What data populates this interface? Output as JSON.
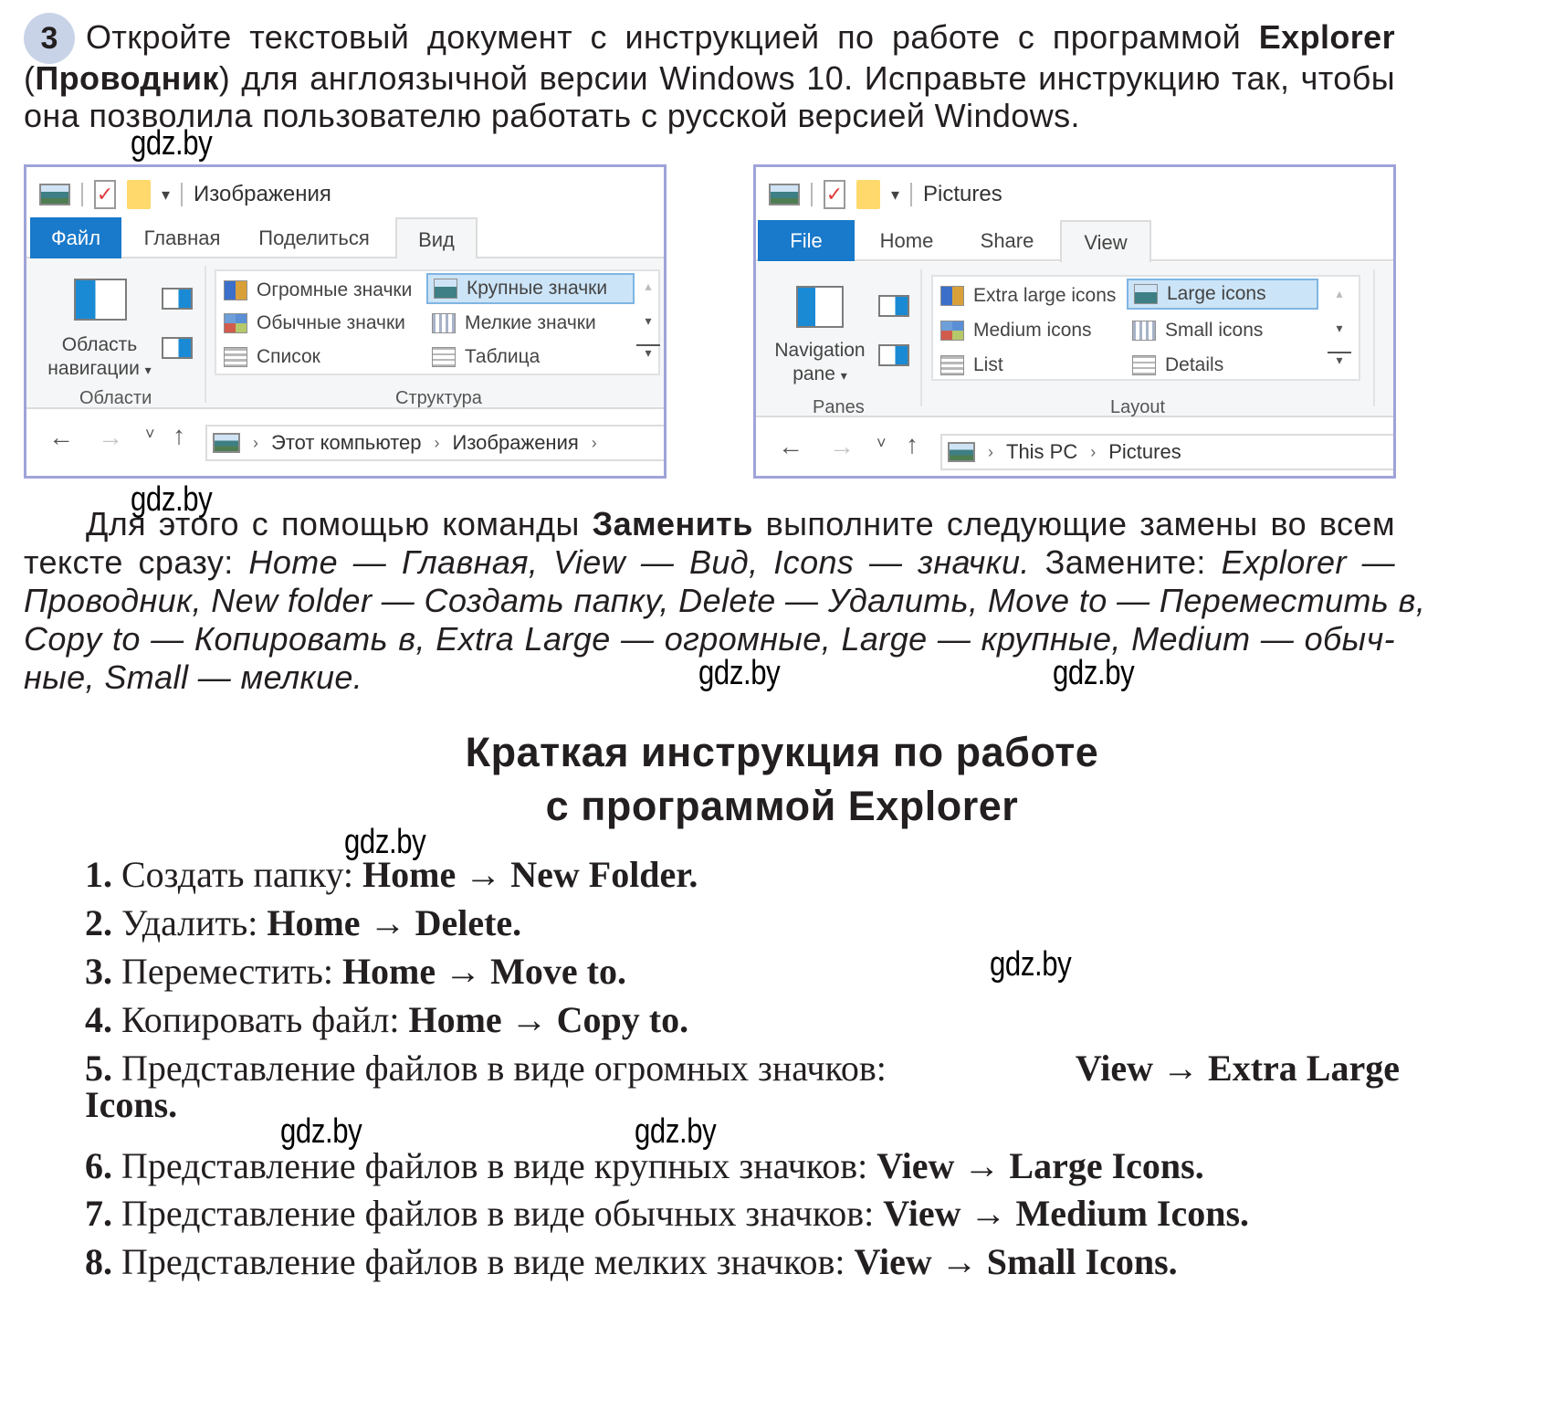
{
  "task": {
    "number": "3",
    "lines": [
      {
        "pre": "Откройте текстовый документ с инструкцией по работе с программой ",
        "bold": "Explorer",
        "post": ""
      },
      {
        "pre": "(",
        "bold": "Проводник",
        "post": ") для англоязычной версии Windows 10. Исправьте инструкцию так, чтобы"
      },
      {
        "pre": "она позволила пользователю работать с русской версией Windows.",
        "bold": "",
        "post": ""
      }
    ]
  },
  "watermarks": [
    "gdz.by",
    "gdz.by",
    "gdz.by",
    "gdz.by",
    "gdz.by",
    "gdz.by",
    "gdz.by",
    "gdz.by",
    "gdz.by",
    "gdz.by"
  ],
  "window_ru": {
    "title": "Изображения",
    "tabs": [
      "Файл",
      "Главная",
      "Поделиться",
      "Вид"
    ],
    "active_tab": "Вид",
    "panes_group": {
      "button": "Область навигации",
      "dropdown": "▾",
      "label": "Области"
    },
    "layout_group": {
      "label": "Структура",
      "items": [
        {
          "label": "Огромные значки",
          "icon": "extra-large-icons-icon",
          "selected": false
        },
        {
          "label": "Крупные значки",
          "icon": "large-icons-icon",
          "selected": true
        },
        {
          "label": "Обычные значки",
          "icon": "medium-icons-icon",
          "selected": false
        },
        {
          "label": "Мелкие значки",
          "icon": "small-icons-icon",
          "selected": false
        },
        {
          "label": "Список",
          "icon": "list-icon",
          "selected": false
        },
        {
          "label": "Таблица",
          "icon": "details-icon",
          "selected": false
        }
      ]
    },
    "address": [
      "Этот компьютер",
      "Изображения"
    ]
  },
  "window_en": {
    "title": "Pictures",
    "tabs": [
      "File",
      "Home",
      "Share",
      "View"
    ],
    "active_tab": "View",
    "panes_group": {
      "button": "Navigation pane",
      "dropdown": "▾",
      "label": "Panes"
    },
    "layout_group": {
      "label": "Layout",
      "items": [
        {
          "label": "Extra large icons",
          "icon": "extra-large-icons-icon",
          "selected": false
        },
        {
          "label": "Large icons",
          "icon": "large-icons-icon",
          "selected": true
        },
        {
          "label": "Medium icons",
          "icon": "medium-icons-icon",
          "selected": false
        },
        {
          "label": "Small icons",
          "icon": "small-icons-icon",
          "selected": false
        },
        {
          "label": "List",
          "icon": "list-icon",
          "selected": false
        },
        {
          "label": "Details",
          "icon": "details-icon",
          "selected": false
        }
      ]
    },
    "address": [
      "This PC",
      "Pictures"
    ]
  },
  "nav_glyphs": {
    "back": "←",
    "forward": "→",
    "recent": "˅",
    "up": "↑",
    "chevron": "›",
    "scroll_up": "▴",
    "scroll_down": "▾",
    "scroll_more": "▿"
  },
  "replace_paragraph": {
    "lines": [
      [
        {
          "t": "Для этого с помощью команды ",
          "s": "n"
        },
        {
          "t": "Заменить",
          "s": "b"
        },
        {
          "t": " выполните следующие замены во всем",
          "s": "n"
        }
      ],
      [
        {
          "t": "тексте сразу: ",
          "s": "n"
        },
        {
          "t": "Home — Главная, View — Вид, Icons — значки.",
          "s": "i"
        },
        {
          "t": " Замените: ",
          "s": "n"
        },
        {
          "t": "Explorer —",
          "s": "i"
        }
      ],
      [
        {
          "t": "Проводник, New folder — Создать папку, Delete — Удалить, Move to — Переместить в,",
          "s": "i"
        }
      ],
      [
        {
          "t": "Copy to — Копировать в, Extra Large — огромные, Large — крупные, Medium — обыч-",
          "s": "i"
        }
      ],
      [
        {
          "t": "ные, Small — мелкие.",
          "s": "i"
        }
      ]
    ]
  },
  "heading": {
    "line1": "Краткая инструкция по работе",
    "line2": "с программой Explorer"
  },
  "instructions": [
    {
      "n": "1.",
      "text": "Создать папку: ",
      "cmd": "Home → New Folder."
    },
    {
      "n": "2.",
      "text": "Удалить: ",
      "cmd": "Home → Delete."
    },
    {
      "n": "3.",
      "text": "Переместить: ",
      "cmd": "Home → Move to."
    },
    {
      "n": "4.",
      "text": "Копировать файл: ",
      "cmd": "Home → Copy to."
    },
    {
      "n": "5.",
      "text": "Представление файлов в виде огромных значков: ",
      "cmd": "View → Extra Large",
      "cont": "Icons."
    },
    {
      "n": "6.",
      "text": "Представление файлов в виде крупных значков: ",
      "cmd": "View → Large Icons."
    },
    {
      "n": "7.",
      "text": "Представление файлов в виде обычных значков: ",
      "cmd": "View → Medium Icons."
    },
    {
      "n": "8.",
      "text": "Представление файлов в виде мелких значков: ",
      "cmd": "View → Small Icons."
    }
  ],
  "colors": {
    "file_tab": "#1979ca",
    "window_border": "#9fa3d8",
    "selection": "#cce4f7",
    "task_badge": "#c9d3e8"
  }
}
